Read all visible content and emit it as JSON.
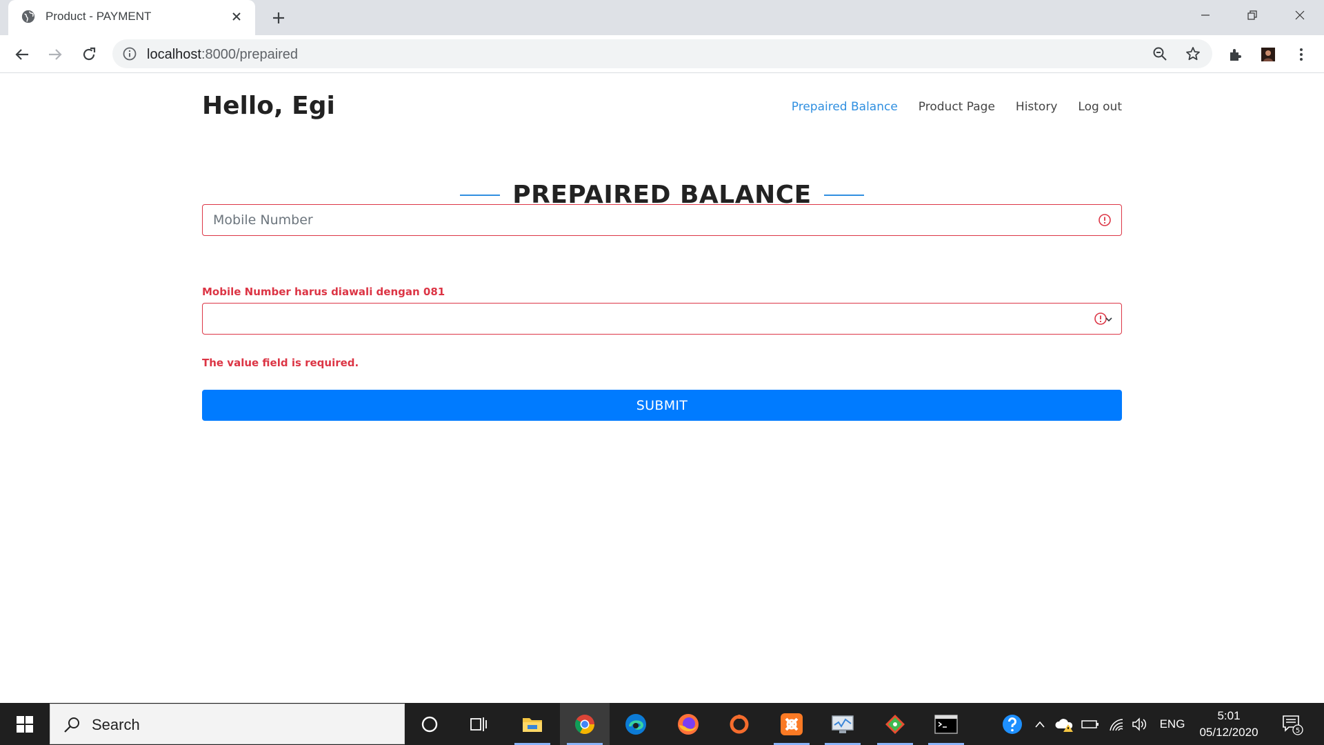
{
  "browser": {
    "tab_title": "Product - PAYMENT",
    "url_host": "localhost",
    "url_path": ":8000/prepaired"
  },
  "page": {
    "greeting": "Hello, Egi",
    "nav": [
      {
        "label": "Prepaired Balance",
        "active": true
      },
      {
        "label": "Product Page",
        "active": false
      },
      {
        "label": "History",
        "active": false
      },
      {
        "label": "Log out",
        "active": false
      }
    ],
    "section_title": "PREPAIRED BALANCE",
    "form": {
      "mobile_placeholder": "Mobile Number",
      "mobile_value": "",
      "mobile_error": "Mobile Number harus diawali dengan 081",
      "value_selected": "",
      "value_error": "The value field is required.",
      "submit_label": "SUBMIT"
    },
    "colors": {
      "accent": "#2f8fe0",
      "error": "#dc3545",
      "button": "#007bff"
    }
  },
  "taskbar": {
    "search_placeholder": "Search",
    "language": "ENG",
    "time": "5:01",
    "date": "05/12/2020",
    "notification_count": "5",
    "apps": [
      "cortana-icon",
      "task-view-icon",
      "file-explorer-icon",
      "chrome-icon",
      "edge-icon",
      "firefox-icon",
      "origin-icon",
      "xampp-icon",
      "performance-monitor-icon",
      "git-icon",
      "terminal-icon"
    ]
  }
}
